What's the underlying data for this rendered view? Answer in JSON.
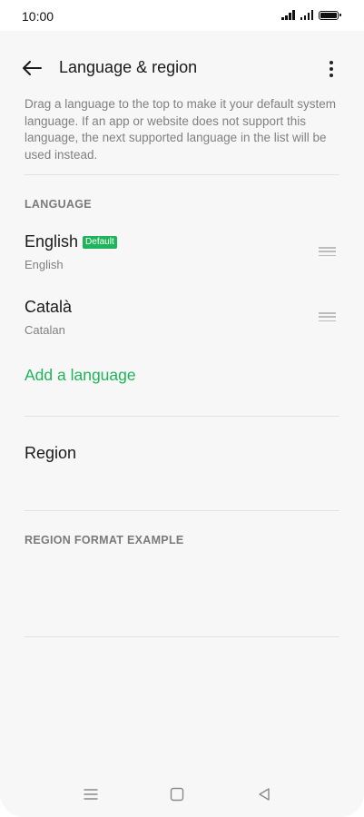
{
  "status_bar": {
    "time": "10:00"
  },
  "app_bar": {
    "title": "Language & region"
  },
  "description": "Drag a language to the top to make it your default system language. If an app or website does not support this language, the next supported language in the list will be used instead.",
  "language_section": {
    "header": "LANGUAGE",
    "items": [
      {
        "name": "English",
        "badge": "Default",
        "subtitle": "English"
      },
      {
        "name": "Català",
        "subtitle": "Catalan"
      }
    ],
    "add_label": "Add a language"
  },
  "region": {
    "label": "Region"
  },
  "region_format": {
    "header": "REGION FORMAT EXAMPLE"
  },
  "colors": {
    "accent": "#1fb45a",
    "background": "#f7f7f7",
    "secondary_text": "#808080"
  },
  "icons": {
    "back": "arrow-left-icon",
    "more": "more-vertical-icon",
    "drag": "drag-handle-icon",
    "nav_menu": "menu-icon",
    "nav_home": "home-square-icon",
    "nav_back": "back-triangle-icon"
  }
}
